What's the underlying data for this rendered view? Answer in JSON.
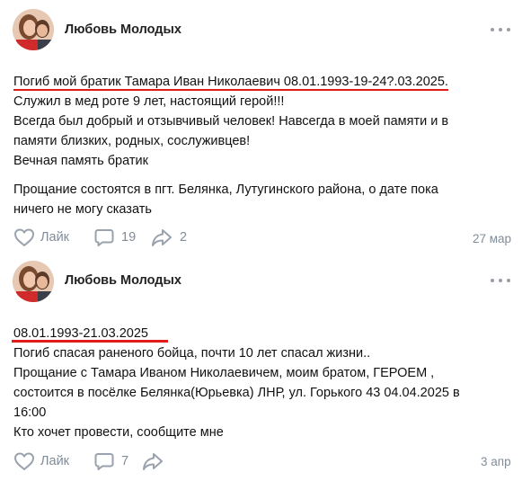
{
  "posts": [
    {
      "author": "Любовь Молодых",
      "lines": [
        "Погиб мой братик Тамара Иван Николаевич 08.01.1993-19-24?.03.2025.",
        "Служил в мед роте 9 лет, настоящий герой!!!",
        "Всегда был добрый и отзывчивый человек! Навсегда в моей памяти и в",
        "памяти близких, родных, сослуживцев!",
        "Вечная память братик",
        "Прощание состоятся в пгт. Белянка, Лутугинского района, о дате пока",
        "ничего не могу сказать"
      ],
      "like_label": "Лайк",
      "comments": "19",
      "shares": "2",
      "date": "27 мар"
    },
    {
      "author": "Любовь Молодых",
      "lines": [
        "08.01.1993-21.03.2025",
        "Погиб спасая раненого бойца, почти 10 лет спасал жизни..",
        "Прощание с Тамара Иваном Николаевичем, моим братом, ГЕРОЕМ ,",
        "состоится в посёлке Белянка(Юрьевка) ЛНР, ул. Горького 43 04.04.2025 в",
        "16:00",
        "Кто хочет провести, сообщите мне"
      ],
      "like_label": "Лайк",
      "comments": "7",
      "shares": "",
      "date": "3 апр"
    }
  ],
  "icons": {
    "like": "heart-outline-icon",
    "comment": "comment-bubble-icon",
    "share": "share-arrow-icon",
    "more": "more-dots-icon"
  },
  "colors": {
    "underline": "#e11a1a",
    "muted": "#818c99",
    "text": "#111111"
  }
}
